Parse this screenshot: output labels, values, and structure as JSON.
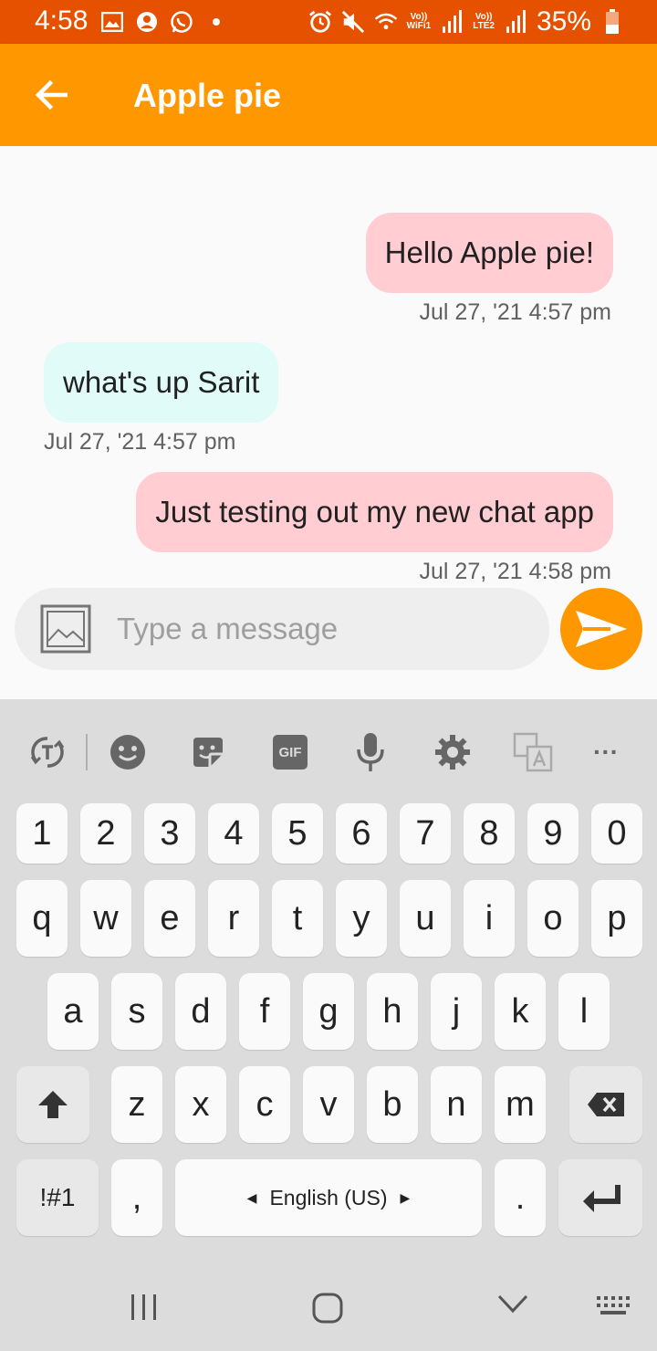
{
  "status_bar": {
    "time": "4:58",
    "signal1_label_top": "Vo))",
    "signal1_label_bottom": "WiFi1",
    "signal2_label_top": "Vo))",
    "signal2_label_bottom": "LTE2",
    "battery": "35%"
  },
  "app_bar": {
    "title": "Apple pie",
    "back_icon": "arrow-left-icon",
    "color": "#ff9800"
  },
  "messages": [
    {
      "direction": "outgoing",
      "text": "Hello Apple pie!",
      "timestamp": "Jul 27, '21 4:57 pm"
    },
    {
      "direction": "incoming",
      "text": "what's up Sarit",
      "timestamp": "Jul 27, '21 4:57 pm"
    },
    {
      "direction": "outgoing",
      "text": "Just testing out my new chat app",
      "timestamp": "Jul 27, '21 4:58 pm"
    }
  ],
  "composer": {
    "placeholder": "Type a message",
    "value": "",
    "image_icon": "image-icon",
    "send_icon": "send-icon"
  },
  "keyboard": {
    "toolbar": [
      "translate-icon",
      "emoji-icon",
      "sticker-icon",
      "gif-icon",
      "mic-icon",
      "settings-icon",
      "translate-text-icon",
      "more-icon"
    ],
    "gif_label": "GIF",
    "more_label": "···",
    "row_numbers": [
      "1",
      "2",
      "3",
      "4",
      "5",
      "6",
      "7",
      "8",
      "9",
      "0"
    ],
    "row_q": [
      "q",
      "w",
      "e",
      "r",
      "t",
      "y",
      "u",
      "i",
      "o",
      "p"
    ],
    "row_a": [
      "a",
      "s",
      "d",
      "f",
      "g",
      "h",
      "j",
      "k",
      "l"
    ],
    "row_z": [
      "z",
      "x",
      "c",
      "v",
      "b",
      "n",
      "m"
    ],
    "symbols_label": "!#1",
    "comma": ",",
    "space_label": "English (US)",
    "period": "."
  },
  "nav_bar": {
    "items": [
      "recents-icon",
      "home-icon",
      "back-chevron-icon",
      "keyboard-icon"
    ]
  }
}
